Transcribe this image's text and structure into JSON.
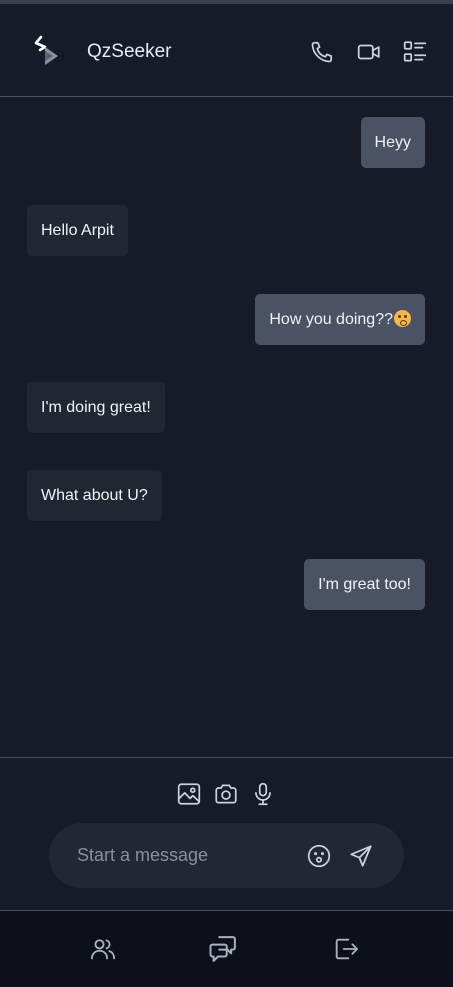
{
  "header": {
    "title": "QzSeeker",
    "icons": [
      "phone-icon",
      "video-camera-icon",
      "menu-list-icon"
    ]
  },
  "messages": [
    {
      "direction": "outgoing",
      "text": "Heyy"
    },
    {
      "direction": "incoming",
      "text": "Hello Arpit"
    },
    {
      "direction": "outgoing",
      "text": "How you doing??",
      "emoji": "face-emoji"
    },
    {
      "direction": "incoming",
      "text": "I'm doing great!"
    },
    {
      "direction": "incoming",
      "text": "What about U?"
    },
    {
      "direction": "outgoing",
      "text": "I'm great too!"
    }
  ],
  "composer": {
    "placeholder": "Start a message",
    "attach_icons": [
      "image-icon",
      "camera-icon",
      "microphone-icon"
    ],
    "input_icons": [
      "emoji-icon",
      "send-icon"
    ]
  },
  "bottom_nav": {
    "icons": [
      "users-icon",
      "chats-icon",
      "logout-icon"
    ]
  },
  "colors": {
    "background": "#161a29",
    "outgoing_bubble": "#4a5263",
    "incoming_bubble": "#222633",
    "input_background": "#232734",
    "bottom_nav": "#0d1019"
  }
}
